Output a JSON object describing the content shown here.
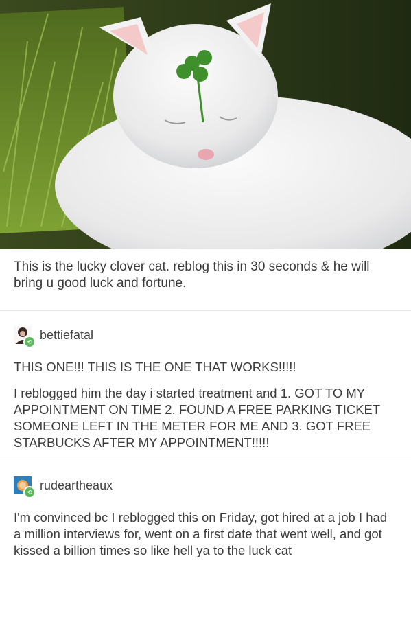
{
  "post": {
    "caption": "This is the lucky clover cat. reblog this in 30 seconds & he will bring u good luck and fortune."
  },
  "reblogs": [
    {
      "username": "bettiefatal",
      "paragraphs": [
        "THIS ONE!!! THIS IS THE ONE THAT WORKS!!!!!",
        "I reblogged him the day i started treatment and 1. GOT TO MY APPOINTMENT ON TIME 2. FOUND A FREE PARKING TICKET SOMEONE LEFT IN THE METER FOR ME AND 3. GOT FREE STARBUCKS AFTER MY APPOINTMENT!!!!!"
      ]
    },
    {
      "username": "rudeartheaux",
      "paragraphs": [
        "I'm convinced bc I reblogged this on Friday, got hired at a job I had a million interviews for, went on a first date that went well, and got kissed a billion times so like hell ya to the luck cat"
      ]
    }
  ],
  "icons": {
    "reblog": "reblog-icon",
    "clover": "four-leaf-clover"
  },
  "colors": {
    "reblog_badge": "#5cb85c",
    "text": "#3d3d3d"
  }
}
